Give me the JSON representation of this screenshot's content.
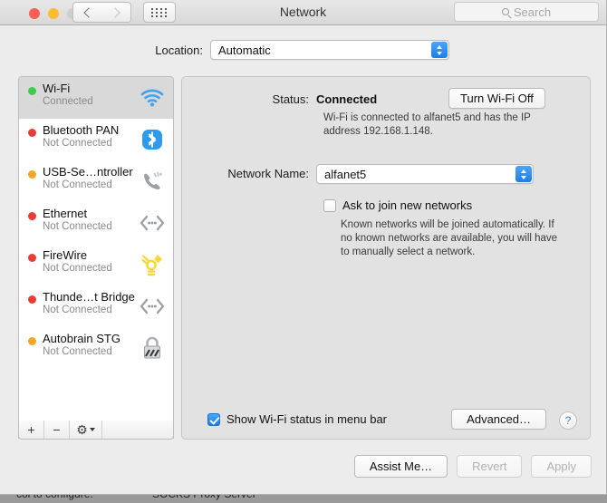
{
  "window": {
    "title": "Network",
    "traffic_lights": [
      "close",
      "minimize",
      "zoom"
    ],
    "nav_back_icon": "chevron-left-icon",
    "nav_forward_icon": "chevron-right-icon",
    "grid_icon": "grid-view-icon"
  },
  "search": {
    "placeholder": "Search",
    "icon": "search-icon"
  },
  "location": {
    "label": "Location:",
    "value": "Automatic"
  },
  "sidebar": {
    "services": [
      {
        "name": "Wi-Fi",
        "state": "Connected",
        "status_color": "#3ecb4a",
        "icon": "wifi-icon",
        "selected": true
      },
      {
        "name": "Bluetooth PAN",
        "state": "Not Connected",
        "status_color": "#ee3b33",
        "icon": "bluetooth-icon",
        "selected": false
      },
      {
        "name": "USB-Se…ntroller",
        "state": "Not Connected",
        "status_color": "#f5a623",
        "icon": "modem-icon",
        "selected": false
      },
      {
        "name": "Ethernet",
        "state": "Not Connected",
        "status_color": "#ee3b33",
        "icon": "ethernet-icon",
        "selected": false
      },
      {
        "name": "FireWire",
        "state": "Not Connected",
        "status_color": "#ee3b33",
        "icon": "firewire-icon",
        "selected": false
      },
      {
        "name": "Thunde…t Bridge",
        "state": "Not Connected",
        "status_color": "#ee3b33",
        "icon": "ethernet-icon",
        "selected": false
      },
      {
        "name": "Autobrain STG",
        "state": "Not Connected",
        "status_color": "#f5a623",
        "icon": "lock-icon",
        "selected": false
      }
    ],
    "toolbar": {
      "add_label": "+",
      "remove_label": "−",
      "gear_label": "⚙"
    }
  },
  "detail": {
    "status_label": "Status:",
    "status_value": "Connected",
    "turn_off_button": "Turn Wi-Fi Off",
    "status_description": "Wi-Fi is connected to alfanet5 and has the IP address 192.168.1.148.",
    "network_name_label": "Network Name:",
    "network_name_value": "alfanet5",
    "ask_join_label": "Ask to join new networks",
    "ask_join_checked": false,
    "ask_join_description": "Known networks will be joined automatically. If no known networks are available, you will have to manually select a network.",
    "show_status_label": "Show Wi-Fi status in menu bar",
    "show_status_checked": true,
    "advanced_button": "Advanced…",
    "help_button": "?"
  },
  "footer": {
    "assist_me": "Assist Me…",
    "revert": "Revert",
    "apply": "Apply",
    "revert_enabled": false,
    "apply_enabled": false
  },
  "background_window": {
    "label": "col to configure:",
    "value": "SOCKS Proxy Server"
  },
  "colors": {
    "accent_blue": "#1a7fe8",
    "window_bg": "#ececec",
    "panel_bg": "#e2e2e2",
    "selection": "#d9d9d9"
  }
}
